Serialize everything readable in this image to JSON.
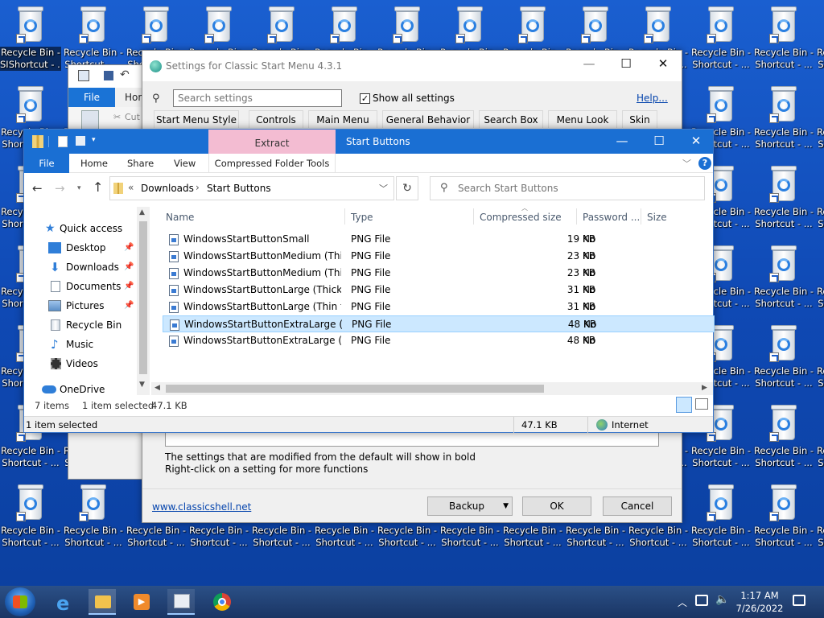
{
  "desktop": {
    "icon_label": "Recycle Bin - Shortcut - ...",
    "icon_label_line1": "Recycle Bin -",
    "icon_label_line2": "Shortcut - ...",
    "selected_label_line1": "Recycle Bin -",
    "selected_label_line2": "SIShortcut - ..."
  },
  "settings": {
    "title": "Settings for Classic Start Menu 4.3.1",
    "search_placeholder": "Search settings",
    "show_all_label": "Show all settings",
    "help_link": "Help...",
    "tabs": [
      "Start Menu Style",
      "Controls",
      "Main Menu",
      "General Behavior",
      "Search Box",
      "Menu Look",
      "Skin"
    ],
    "hint1": "The settings that are modified from the default will show in bold",
    "hint2": "Right-click on a setting for more functions",
    "website": "www.classicshell.net",
    "backup_label": "Backup",
    "ok_label": "OK",
    "cancel_label": "Cancel"
  },
  "behind": {
    "file_tab": "File",
    "home_tab": "Hon",
    "cut_label": "Cut"
  },
  "explorer": {
    "title": "Start Buttons",
    "context_tab": "Extract",
    "tabs": {
      "file": "File",
      "home": "Home",
      "share": "Share",
      "view": "View",
      "tools": "Compressed Folder Tools"
    },
    "path": {
      "prefix": "«",
      "part1": "Downloads",
      "separator": "›",
      "part2": "Start Buttons"
    },
    "search_placeholder": "Search Start Buttons",
    "nav": [
      {
        "label": "Quick access"
      },
      {
        "label": "Desktop"
      },
      {
        "label": "Downloads"
      },
      {
        "label": "Documents"
      },
      {
        "label": "Pictures"
      },
      {
        "label": "Recycle Bin"
      },
      {
        "label": "Music"
      },
      {
        "label": "Videos"
      },
      {
        "label": "OneDrive"
      }
    ],
    "columns": {
      "name": "Name",
      "type": "Type",
      "compressed": "Compressed size",
      "password": "Password ...",
      "size": "Size"
    },
    "files": [
      {
        "name": "WindowsStartButtonSmall",
        "type": "PNG File",
        "compressed": "19 KB",
        "password": "No"
      },
      {
        "name": "WindowsStartButtonMedium (Thic...",
        "type": "PNG File",
        "compressed": "23 KB",
        "password": "No"
      },
      {
        "name": "WindowsStartButtonMedium (Thin...",
        "type": "PNG File",
        "compressed": "23 KB",
        "password": "No"
      },
      {
        "name": "WindowsStartButtonLarge (Thick t...",
        "type": "PNG File",
        "compressed": "31 KB",
        "password": "No"
      },
      {
        "name": "WindowsStartButtonLarge (Thin ta...",
        "type": "PNG File",
        "compressed": "31 KB",
        "password": "No"
      },
      {
        "name": "WindowsStartButtonExtraLarge (Th...",
        "type": "PNG File",
        "compressed": "48 KB",
        "password": "No"
      },
      {
        "name": "WindowsStartButtonExtraLarge (Th...",
        "type": "PNG File",
        "compressed": "48 KB",
        "password": "No"
      }
    ],
    "status_items": "7 items",
    "status_selected": "1 item selected",
    "status_size": "47.1 KB"
  },
  "statusbar2": {
    "selected": "1 item selected",
    "size": "47.1 KB",
    "zone": "Internet"
  },
  "taskbar": {
    "time": "1:17 AM",
    "date": "7/26/2022"
  },
  "colors": {
    "desktop": "#1452c0",
    "accent": "#0078d7",
    "selection": "#cce8ff",
    "taskbar": "#1d3f72"
  }
}
